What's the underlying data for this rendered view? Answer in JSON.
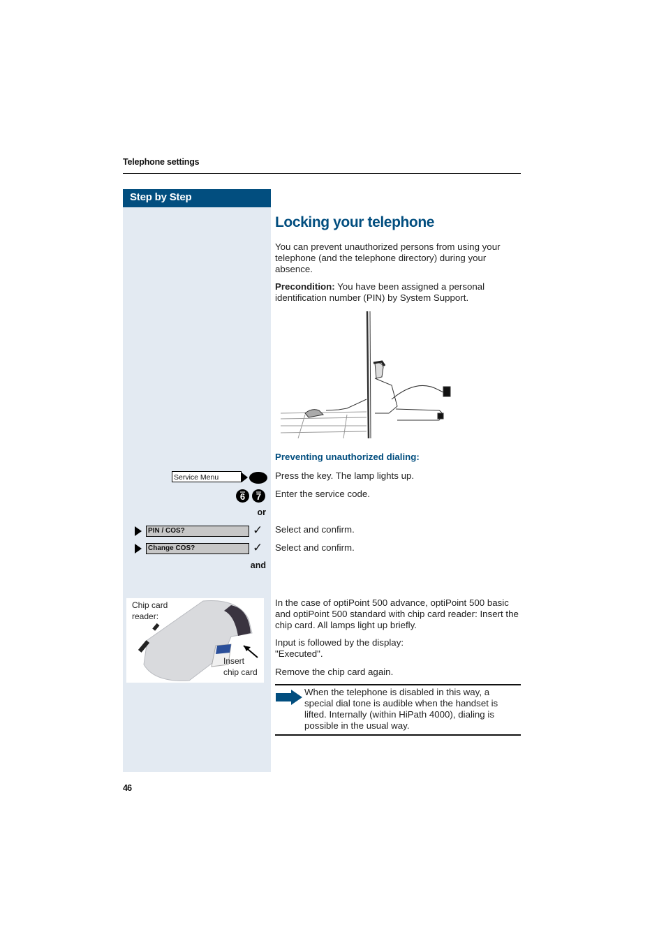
{
  "header": {
    "section": "Telephone settings",
    "step_by_step": "Step by Step"
  },
  "title": "Locking your telephone",
  "intro": "You can prevent unauthorized persons from using your telephone (and the telephone directory) during your absence.",
  "precondition": {
    "label": "Precondition:",
    "text": " You have been assigned a personal identification number (PIN) by System Support."
  },
  "subheading": "Preventing unauthorized dialing:",
  "steps": {
    "service_key_label": "Service Menu",
    "press_key": "Press the key. The lamp lights up.",
    "digits": [
      "6",
      "7"
    ],
    "enter_code": "Enter the service code.",
    "or_label": "or",
    "menu_items": [
      {
        "label": "PIN / COS?",
        "action": "Select and confirm."
      },
      {
        "label": "Change COS?",
        "action": "Select and confirm."
      }
    ],
    "and_label": "and"
  },
  "chip_card": {
    "panel_label_line1": "Chip card",
    "panel_label_line2": "reader:",
    "insert_line1": "Insert",
    "insert_line2": "chip card",
    "instruction": "In the case of optiPoint 500 advance, optiPoint 500 basic and optiPoint 500 standard with chip card reader: Insert the chip card. All lamps light up briefly.",
    "display_line1": "Input is followed by the display:",
    "display_line2": "\"Executed\".",
    "remove": "Remove the chip card again."
  },
  "note": "When the telephone is disabled in this way, a special dial tone is audible when the handset is lifted. Internally (within HiPath 4000), dialing is possible in the usual way.",
  "page_number": "46",
  "colors": {
    "brand_blue": "#024e7f",
    "sidebar_bg": "#e3eaf2"
  }
}
